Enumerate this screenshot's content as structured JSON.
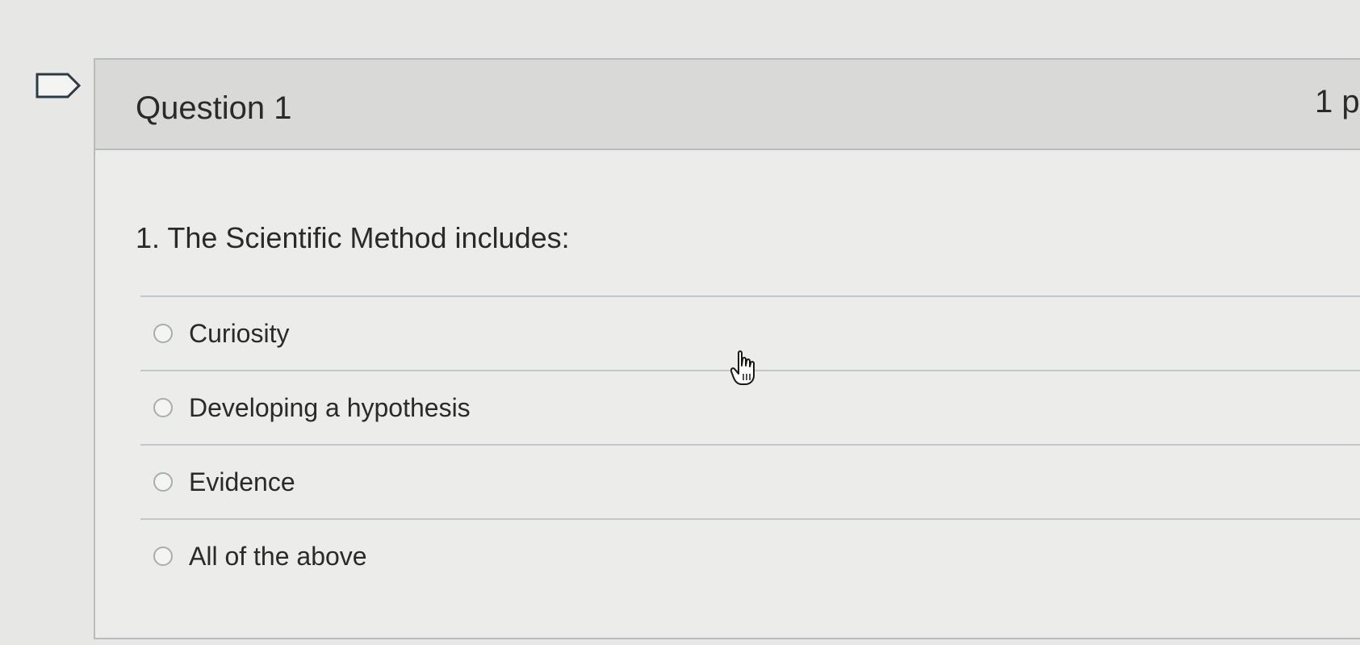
{
  "question": {
    "title": "Question 1",
    "points": "1 p",
    "text": "1. The Scientific Method includes:",
    "options": [
      {
        "label": "Curiosity"
      },
      {
        "label": "Developing a hypothesis"
      },
      {
        "label": "Evidence"
      },
      {
        "label": "All of the above"
      }
    ]
  },
  "icons": {
    "flag": "flag-icon",
    "cursor": "hand-pointer-icon"
  },
  "colors": {
    "background": "#e7e7e5",
    "header_background": "#d9dad8",
    "border": "#b8bcbf",
    "text": "#2a2a2a"
  }
}
